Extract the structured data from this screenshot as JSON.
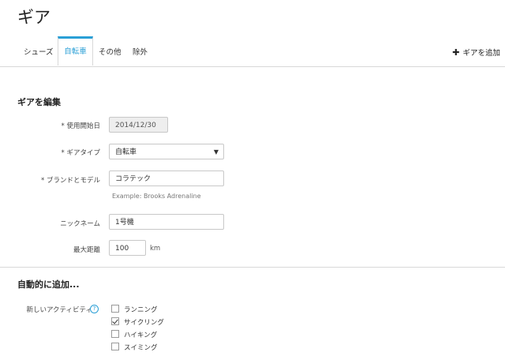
{
  "page": {
    "title": "ギア"
  },
  "tabs": [
    {
      "label": "シューズ",
      "active": false
    },
    {
      "label": "自転車",
      "active": true
    },
    {
      "label": "その他",
      "active": false
    },
    {
      "label": "除外",
      "active": false
    }
  ],
  "add_gear": {
    "label": "ギアを追加"
  },
  "edit_section": {
    "title": "ギアを編集",
    "start_date": {
      "label": "* 使用開始日",
      "value": "2014/12/30"
    },
    "gear_type": {
      "label": "* ギアタイプ",
      "value": "自転車"
    },
    "brand_model": {
      "label": "* ブランドとモデル",
      "value": "コラテック",
      "hint": "Example: Brooks Adrenaline"
    },
    "nickname": {
      "label": "ニックネーム",
      "value": "1号機"
    },
    "max_distance": {
      "label": "最大距離",
      "value": "100",
      "unit": "km"
    }
  },
  "auto_add_section": {
    "title": "自動的に追加...",
    "new_activity_label": "新しいアクティビティ",
    "options": [
      {
        "label": "ランニング",
        "checked": false
      },
      {
        "label": "サイクリング",
        "checked": true
      },
      {
        "label": "ハイキング",
        "checked": false
      },
      {
        "label": "スイミング",
        "checked": false
      }
    ]
  },
  "colors": {
    "accent": "#2a9fd6",
    "divider": "#d8d8d8"
  }
}
